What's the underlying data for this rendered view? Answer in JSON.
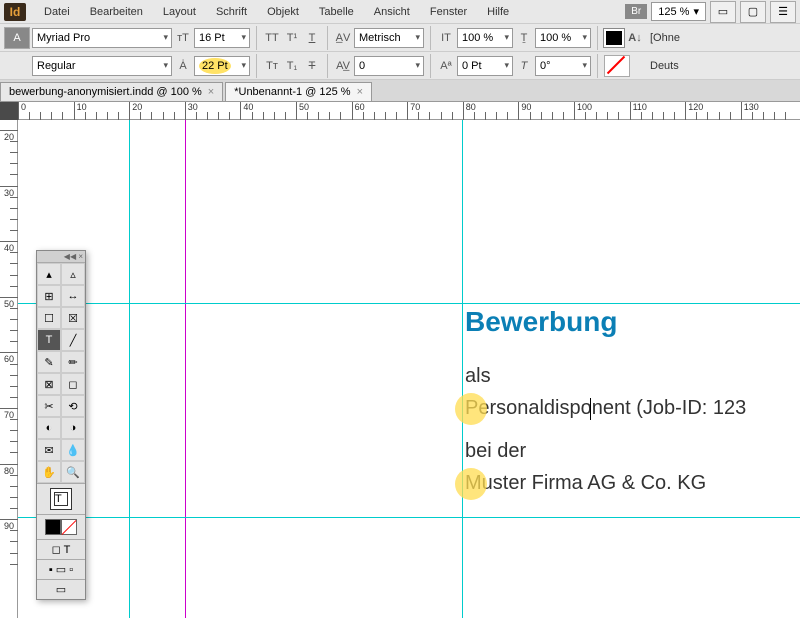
{
  "menu": {
    "items": [
      "Datei",
      "Bearbeiten",
      "Layout",
      "Schrift",
      "Objekt",
      "Tabelle",
      "Ansicht",
      "Fenster",
      "Hilfe"
    ],
    "br": "Br",
    "zoom": "125 %"
  },
  "ctrl": {
    "font": "Myriad Pro",
    "style": "Regular",
    "size": "16 Pt",
    "leading": "22 Pt",
    "kerning": "Metrisch",
    "tracking": "0",
    "vscale": "100 %",
    "hscale": "100 %",
    "baseline": "0 Pt",
    "skew": "0°",
    "rightLabel": "[Ohne",
    "deutsch": "Deuts"
  },
  "tabs": [
    {
      "label": "bewerbung-anonymisiert.indd @ 100 %",
      "active": false
    },
    {
      "label": "*Unbenannt-1 @ 125 %",
      "active": true
    }
  ],
  "ruler_h": [
    0,
    10,
    20,
    30,
    40,
    50,
    60,
    70,
    80,
    90,
    100,
    110,
    120,
    130
  ],
  "ruler_v": [
    20,
    30,
    40,
    50,
    60,
    70,
    80,
    90
  ],
  "doc": {
    "heading": "Bewerbung",
    "als": "als",
    "role": "Personaldisponent (Job-ID: 123",
    "bei": "bei der",
    "firma": "Muster Firma AG & Co. KG"
  }
}
